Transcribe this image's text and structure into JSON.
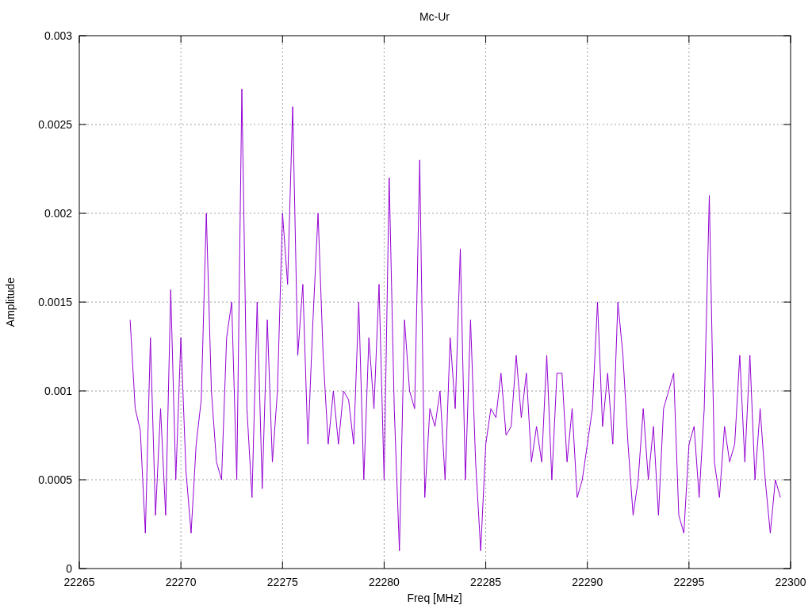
{
  "chart_data": {
    "type": "line",
    "title": "Mc-Ur",
    "xlabel": "Freq [MHz]",
    "ylabel": "Amplitude",
    "x": [
      22267.5,
      22267.75,
      22268,
      22268.25,
      22268.5,
      22268.75,
      22269,
      22269.25,
      22269.5,
      22269.75,
      22270,
      22270.25,
      22270.5,
      22270.75,
      22271,
      22271.25,
      22271.5,
      22271.75,
      22272,
      22272.25,
      22272.5,
      22272.75,
      22273,
      22273.25,
      22273.5,
      22273.75,
      22274,
      22274.25,
      22274.5,
      22274.75,
      22275,
      22275.25,
      22275.5,
      22275.75,
      22276,
      22276.25,
      22276.5,
      22276.75,
      22277,
      22277.25,
      22277.5,
      22277.75,
      22278,
      22278.25,
      22278.5,
      22278.75,
      22279,
      22279.25,
      22279.5,
      22279.75,
      22280,
      22280.25,
      22280.5,
      22280.75,
      22281,
      22281.25,
      22281.5,
      22281.75,
      22282,
      22282.25,
      22282.5,
      22282.75,
      22283,
      22283.25,
      22283.5,
      22283.75,
      22284,
      22284.25,
      22284.5,
      22284.75,
      22285,
      22285.25,
      22285.5,
      22285.75,
      22286,
      22286.25,
      22286.5,
      22286.75,
      22287,
      22287.25,
      22287.5,
      22287.75,
      22288,
      22288.25,
      22288.5,
      22288.75,
      22289,
      22289.25,
      22289.5,
      22289.75,
      22290,
      22290.25,
      22290.5,
      22290.75,
      22291,
      22291.25,
      22291.5,
      22291.75,
      22292,
      22292.25,
      22292.5,
      22292.75,
      22293,
      22293.25,
      22293.5,
      22293.75,
      22294,
      22294.25,
      22294.5,
      22294.75,
      22295,
      22295.25,
      22295.5,
      22295.75,
      22296,
      22296.25,
      22296.5,
      22296.75,
      22297,
      22297.25,
      22297.5,
      22297.75,
      22298,
      22298.25,
      22298.5,
      22298.75,
      22299,
      22299.25,
      22299.5
    ],
    "series": [
      {
        "color": "#9400d3",
        "values": [
          0.0014,
          0.0009,
          0.00078,
          0.0002,
          0.0013,
          0.0003,
          0.0009,
          0.0003,
          0.00157,
          0.0005,
          0.0013,
          0.00055,
          0.0002,
          0.0007,
          0.00095,
          0.002,
          0.001,
          0.0006,
          0.0005,
          0.0013,
          0.0015,
          0.0005,
          0.0027,
          0.0009,
          0.0004,
          0.0015,
          0.00045,
          0.0014,
          0.0006,
          0.001,
          0.002,
          0.0016,
          0.0026,
          0.0012,
          0.0016,
          0.0007,
          0.0014,
          0.002,
          0.0012,
          0.0007,
          0.001,
          0.0007,
          0.001,
          0.00095,
          0.0007,
          0.0015,
          0.0005,
          0.0013,
          0.0009,
          0.0016,
          0.0005,
          0.0022,
          0.0009,
          0.0001,
          0.0014,
          0.001,
          0.0009,
          0.0023,
          0.0004,
          0.0009,
          0.0008,
          0.001,
          0.0005,
          0.0013,
          0.0009,
          0.0018,
          0.0005,
          0.0014,
          0.0006,
          0.0001,
          0.0007,
          0.0009,
          0.00085,
          0.0011,
          0.00075,
          0.0008,
          0.0012,
          0.00085,
          0.0011,
          0.0006,
          0.0008,
          0.0006,
          0.0012,
          0.0005,
          0.0011,
          0.0011,
          0.0006,
          0.0009,
          0.0004,
          0.0005,
          0.0007,
          0.0009,
          0.0015,
          0.0008,
          0.0011,
          0.0007,
          0.0015,
          0.0012,
          0.0007,
          0.0003,
          0.0005,
          0.0009,
          0.0005,
          0.0008,
          0.0003,
          0.0009,
          0.001,
          0.0011,
          0.0003,
          0.0002,
          0.0007,
          0.0008,
          0.0004,
          0.0009,
          0.0021,
          0.0006,
          0.0004,
          0.0008,
          0.0006,
          0.0007,
          0.0012,
          0.0006,
          0.0012,
          0.0005,
          0.0009,
          0.0005,
          0.0002,
          0.0005,
          0.0004
        ]
      }
    ],
    "grid": true,
    "xlim": [
      22265,
      22300
    ],
    "ylim": [
      0,
      0.003
    ],
    "xticks": [
      22265,
      22270,
      22275,
      22280,
      22285,
      22290,
      22295,
      22300
    ],
    "yticks": [
      {
        "value": 0,
        "label": "0"
      },
      {
        "value": 0.0005,
        "label": "0.0005"
      },
      {
        "value": 0.001,
        "label": "0.001"
      },
      {
        "value": 0.0015,
        "label": "0.0015"
      },
      {
        "value": 0.002,
        "label": "0.002"
      },
      {
        "value": 0.0025,
        "label": "0.0025"
      },
      {
        "value": 0.003,
        "label": "0.003"
      }
    ]
  }
}
